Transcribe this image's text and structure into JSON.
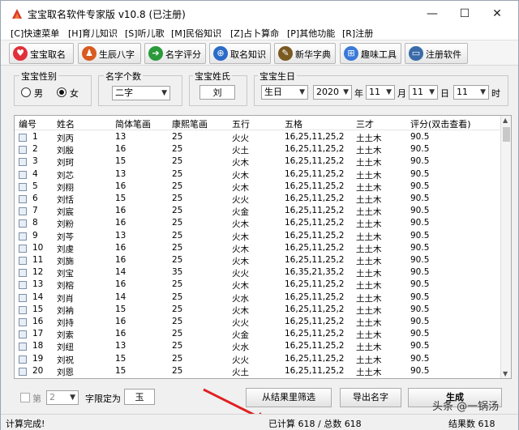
{
  "window": {
    "title": "宝宝取名软件专家版 v10.8 (已注册)",
    "min": "—",
    "max": "☐",
    "close": "✕"
  },
  "menu": [
    "[C]快速菜单",
    "[H]育儿知识",
    "[S]听儿歌",
    "[M]民俗知识",
    "[Z]占卜算命",
    "[P]其他功能",
    "[R]注册"
  ],
  "toolbar": [
    {
      "label": "宝宝取名",
      "icon": "heart-icon",
      "color": "#e0303a",
      "glyph": "♥"
    },
    {
      "label": "生辰八字",
      "icon": "person-icon",
      "color": "#d85a20",
      "glyph": "♟"
    },
    {
      "label": "名字评分",
      "icon": "arrow-right-icon",
      "color": "#2a9a3a",
      "glyph": "➔"
    },
    {
      "label": "取名知识",
      "icon": "globe-icon",
      "color": "#2a6cc8",
      "glyph": "⊕"
    },
    {
      "label": "新华字典",
      "icon": "scholar-icon",
      "color": "#7a5a20",
      "glyph": "✎"
    },
    {
      "label": "趣味工具",
      "icon": "windows-icon",
      "color": "#3a7ad8",
      "glyph": "⊞"
    },
    {
      "label": "注册软件",
      "icon": "monitor-icon",
      "color": "#3a6aa8",
      "glyph": "▭"
    }
  ],
  "form": {
    "gender": {
      "label": "宝宝性别",
      "male": "男",
      "female": "女",
      "selected": "female"
    },
    "name_count": {
      "label": "名字个数",
      "value": "二字"
    },
    "surname": {
      "label": "宝宝姓氏",
      "value": "刘"
    },
    "birthday": {
      "label": "宝宝生日",
      "calendar": "生日",
      "year": "2020",
      "year_unit": "年",
      "month": "11",
      "month_unit": "月",
      "day": "11",
      "day_unit": "日",
      "hour": "11",
      "hour_unit": "时"
    }
  },
  "table": {
    "headers": [
      "编号",
      "姓名",
      "简体笔画",
      "康熙笔画",
      "五行",
      "五格",
      "三才",
      "评分(双击查看)"
    ],
    "rows": [
      [
        "1",
        "刘丙",
        "13",
        "25",
        "火火",
        "16,25,11,25,2",
        "土土木",
        "90.5"
      ],
      [
        "2",
        "刘殷",
        "16",
        "25",
        "火土",
        "16,25,11,25,2",
        "土土木",
        "90.5"
      ],
      [
        "3",
        "刘珂",
        "15",
        "25",
        "火木",
        "16,25,11,25,2",
        "土土木",
        "90.5"
      ],
      [
        "4",
        "刘芯",
        "13",
        "25",
        "火木",
        "16,25,11,25,2",
        "土土木",
        "90.5"
      ],
      [
        "5",
        "刘栩",
        "16",
        "25",
        "火木",
        "16,25,11,25,2",
        "土土木",
        "90.5"
      ],
      [
        "6",
        "刘恬",
        "15",
        "25",
        "火火",
        "16,25,11,25,2",
        "土土木",
        "90.5"
      ],
      [
        "7",
        "刘宸",
        "16",
        "25",
        "火金",
        "16,25,11,25,2",
        "土土木",
        "90.5"
      ],
      [
        "8",
        "刘粉",
        "16",
        "25",
        "火木",
        "16,25,11,25,2",
        "土土木",
        "90.5"
      ],
      [
        "9",
        "刘芩",
        "13",
        "25",
        "火木",
        "16,25,11,25,2",
        "土土木",
        "90.5"
      ],
      [
        "10",
        "刘虔",
        "16",
        "25",
        "火木",
        "16,25,11,25,2",
        "土土木",
        "90.5"
      ],
      [
        "11",
        "刘旆",
        "16",
        "25",
        "火木",
        "16,25,11,25,2",
        "土土木",
        "90.5"
      ],
      [
        "12",
        "刘宝",
        "14",
        "35",
        "火火",
        "16,35,21,35,2",
        "土土木",
        "90.5"
      ],
      [
        "13",
        "刘榕",
        "16",
        "25",
        "火木",
        "16,25,11,25,2",
        "土土木",
        "90.5"
      ],
      [
        "14",
        "刘肖",
        "14",
        "25",
        "火水",
        "16,25,11,25,2",
        "土土木",
        "90.5"
      ],
      [
        "15",
        "刘衲",
        "15",
        "25",
        "火木",
        "16,25,11,25,2",
        "土土木",
        "90.5"
      ],
      [
        "16",
        "刘持",
        "16",
        "25",
        "火火",
        "16,25,11,25,2",
        "土土木",
        "90.5"
      ],
      [
        "17",
        "刘索",
        "16",
        "25",
        "火金",
        "16,25,11,25,2",
        "土土木",
        "90.5"
      ],
      [
        "18",
        "刘纽",
        "13",
        "25",
        "火水",
        "16,25,11,25,2",
        "土土木",
        "90.5"
      ],
      [
        "19",
        "刘祝",
        "15",
        "25",
        "火火",
        "16,25,11,25,2",
        "土土木",
        "90.5"
      ],
      [
        "20",
        "刘恩",
        "15",
        "25",
        "火土",
        "16,25,11,25,2",
        "土土木",
        "90.5"
      ]
    ]
  },
  "bottom": {
    "nth_label": "第",
    "nth_value": "2",
    "limit_label": "字限定为",
    "limit_value": "玉",
    "filter_button": "从结果里筛选",
    "export_button": "导出名字",
    "generate_button": "生成"
  },
  "status": {
    "left": "计算完成!",
    "center": "已计算 618 / 总数 618",
    "right": "结果数 618"
  },
  "watermark": "头条 @一锅汤",
  "colors": {
    "accent": "#1e6ec8",
    "window_bg": "#f0f0f0",
    "annotation": "#e02020"
  }
}
